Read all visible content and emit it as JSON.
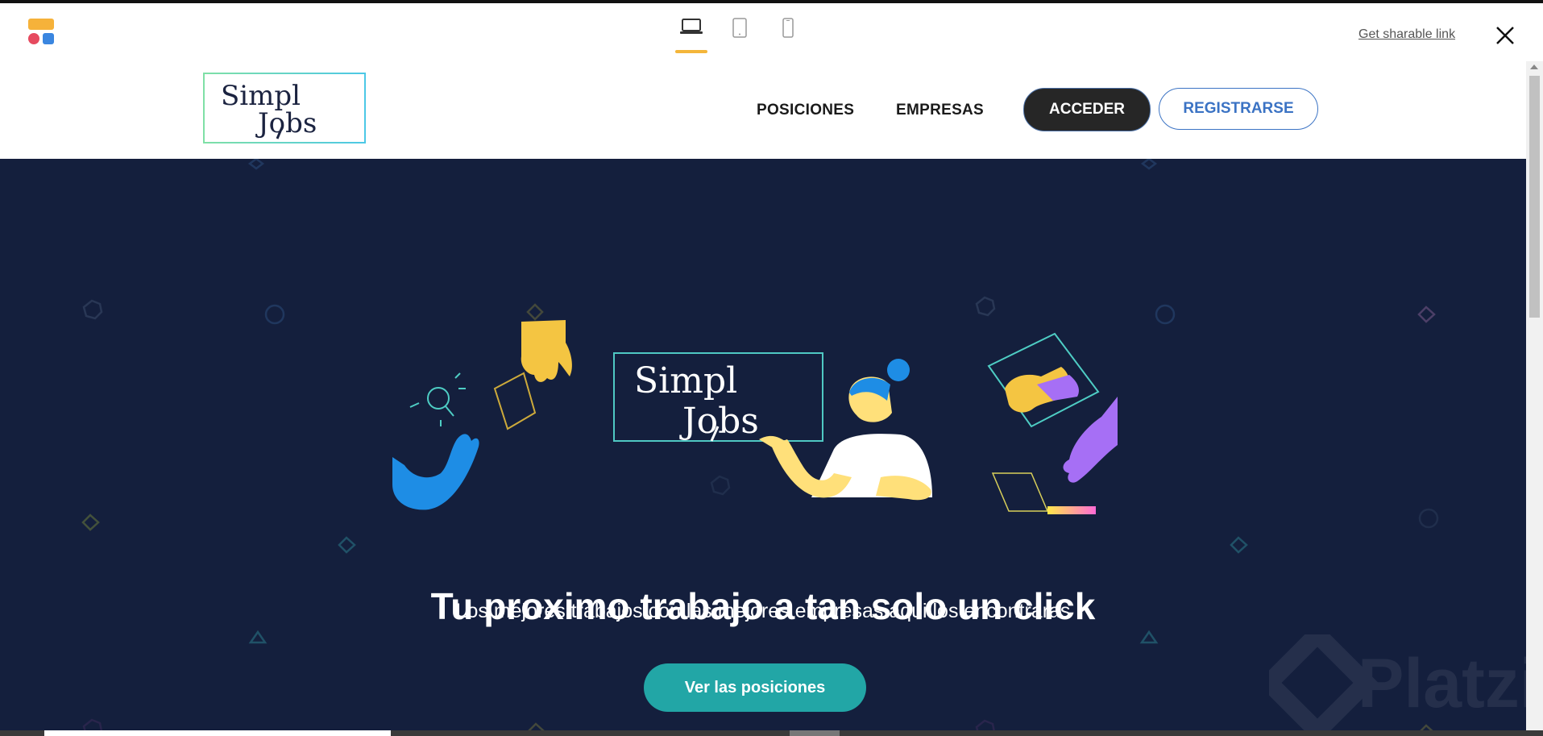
{
  "toolbar": {
    "devices": [
      {
        "name": "desktop",
        "active": true
      },
      {
        "name": "tablet",
        "active": false
      },
      {
        "name": "mobile",
        "active": false
      }
    ],
    "share_link": "Get sharable link"
  },
  "site": {
    "brand": {
      "line1": "Simpl",
      "line2": "Jobs"
    },
    "nav": {
      "positions": "POSICIONES",
      "companies": "EMPRESAS",
      "login": "ACCEDER",
      "register": "REGISTRARSE"
    },
    "hero": {
      "sign": {
        "line1": "Simpl",
        "line2": "Jobs"
      },
      "title": "Tu proximo trabajo a tan solo un click",
      "subtitle": "Los mejores trabajos con las mejores empresas aqui los encontraras",
      "cta": "Ver las posiciones"
    },
    "watermark": "Platzi"
  },
  "colors": {
    "hero_bg": "#141f3d",
    "accent_teal": "#22a6a6",
    "register_blue": "#3b73c4",
    "active_tab": "#f4b63a"
  }
}
